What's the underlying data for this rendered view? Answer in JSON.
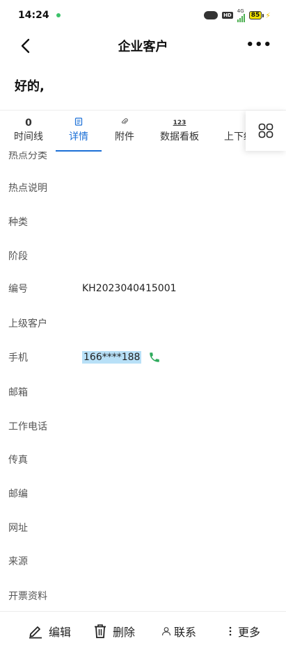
{
  "status_bar": {
    "time": "14:24",
    "network": "4G",
    "battery": "85",
    "hd": "HD"
  },
  "nav": {
    "title": "企业客户",
    "more": "•••"
  },
  "greeting": "好的,",
  "tabs": [
    {
      "top": "0",
      "label": "时间线",
      "icon": "count",
      "active": false
    },
    {
      "top": "",
      "label": "详情",
      "icon": "document-icon",
      "active": true
    },
    {
      "top": "",
      "label": "附件",
      "icon": "paperclip-icon",
      "active": false
    },
    {
      "top": "123",
      "label": "数据看板",
      "icon": "numbers-icon",
      "active": false
    },
    {
      "top": "",
      "label": "上下级",
      "icon": "",
      "active": false
    }
  ],
  "fields": [
    {
      "label": "热点分类",
      "value": ""
    },
    {
      "label": "热点说明",
      "value": ""
    },
    {
      "label": "种类",
      "value": ""
    },
    {
      "label": "阶段",
      "value": ""
    },
    {
      "label": "编号",
      "value": "KH2023040415001"
    },
    {
      "label": "上级客户",
      "value": ""
    },
    {
      "label": "手机",
      "value": "166****188"
    },
    {
      "label": "邮箱",
      "value": ""
    },
    {
      "label": "工作电话",
      "value": ""
    },
    {
      "label": "传真",
      "value": ""
    },
    {
      "label": "邮编",
      "value": ""
    },
    {
      "label": "网址",
      "value": ""
    },
    {
      "label": "来源",
      "value": ""
    },
    {
      "label": "开票资料",
      "value": ""
    }
  ],
  "bottom_actions": {
    "edit": "编辑",
    "delete": "删除",
    "contact": "联系",
    "more": "更多"
  },
  "colors": {
    "accent": "#1a6fd6",
    "phone_green": "#2eaa5c",
    "phone_highlight": "#b8e0f7"
  }
}
